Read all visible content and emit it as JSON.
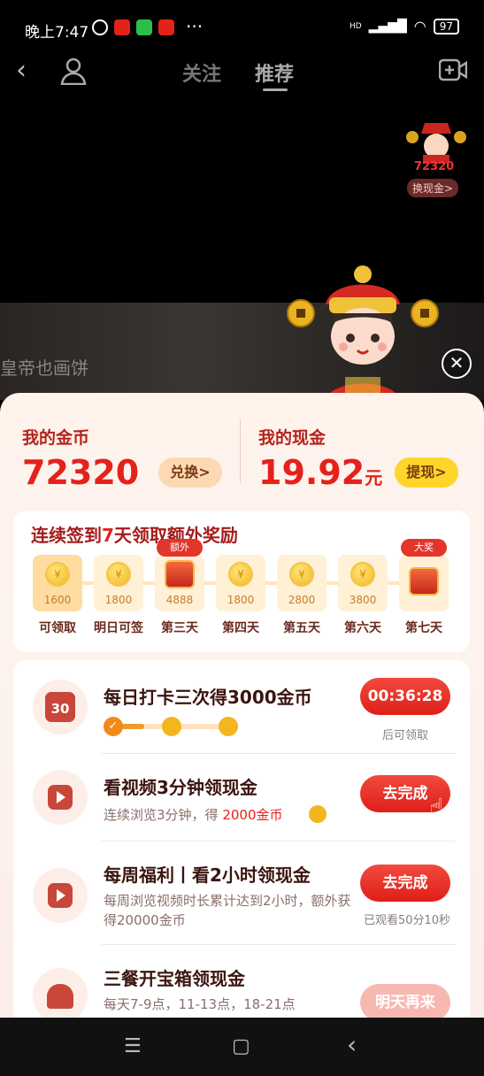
{
  "status": {
    "time": "晚上7:47",
    "dots": "···",
    "net": "HD",
    "battery": "97"
  },
  "nav": {
    "tab_follow": "关注",
    "tab_recommend": "推荐"
  },
  "badge": {
    "coins": "72320",
    "button": "换现金>"
  },
  "video": {
    "subtitle": "皇帝也画饼"
  },
  "wallet": {
    "coins_label": "我的金币",
    "coins_value": "72320",
    "exchange": "兑换>",
    "cash_label": "我的现金",
    "cash_value": "19.92",
    "cash_unit": "元",
    "withdraw": "提现>"
  },
  "signin": {
    "title_pre": "连续签到",
    "title_num": "7",
    "title_post": "天领取额外奖励",
    "days": [
      {
        "amount": "1600",
        "label": "可领取"
      },
      {
        "amount": "1800",
        "label": "明日可签"
      },
      {
        "amount": "4888",
        "label": "第三天",
        "tag": "额外"
      },
      {
        "amount": "1800",
        "label": "第四天"
      },
      {
        "amount": "2800",
        "label": "第五天"
      },
      {
        "amount": "3800",
        "label": "第六天"
      },
      {
        "amount": "",
        "label": "第七天",
        "tag": "大奖"
      }
    ]
  },
  "tasks": [
    {
      "title": "每日打卡三次得3000金币",
      "button": "00:36:28",
      "note": "后可领取",
      "calendar": "30"
    },
    {
      "title": "看视频3分钟领现金",
      "desc_pre": "连续浏览3分钟，得 ",
      "desc_hl": "2000金币",
      "button": "去完成"
    },
    {
      "title": "每周福利丨看2小时领现金",
      "desc": "每周浏览视频时长累计达到2小时，额外获得20000金币",
      "button": "去完成",
      "note": "已观看50分10秒"
    },
    {
      "title": "三餐开宝箱领现金",
      "desc": "每天7-9点，11-13点，18-21点",
      "button": "明天再来"
    }
  ],
  "sysnav": {
    "menu": "☰",
    "home": "▢",
    "back": "‹"
  }
}
